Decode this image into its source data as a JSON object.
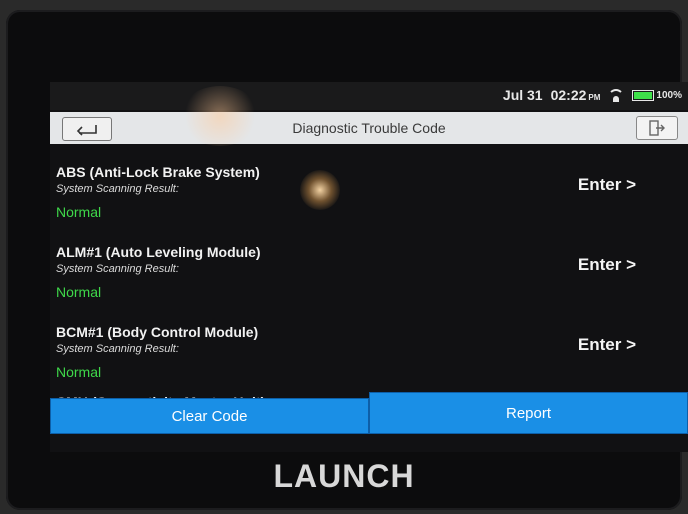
{
  "status_bar": {
    "date": "Jul 31",
    "time": "02:22",
    "ampm": "PM",
    "battery": "100%",
    "battery_level": 1.0
  },
  "header": {
    "title": "Diagnostic Trouble Code"
  },
  "modules": [
    {
      "name": "ABS (Anti-Lock Brake System)",
      "subtitle": "System Scanning Result:",
      "status": "Normal",
      "action": "Enter >"
    },
    {
      "name": "ALM#1 (Auto Leveling Module)",
      "subtitle": "System Scanning Result:",
      "status": "Normal",
      "action": "Enter >"
    },
    {
      "name": "BCM#1 (Body Control Module)",
      "subtitle": "System Scanning Result:",
      "status": "Normal",
      "action": "Enter >"
    },
    {
      "name": "CMU (Connectivity Master Unit)"
    }
  ],
  "footer": {
    "clear_label": "Clear Code",
    "report_label": "Report"
  },
  "brand": "LAUNCH",
  "colors": {
    "accent": "#1a8fe6",
    "normal": "#3fd84a",
    "battery": "#3fe04a"
  }
}
